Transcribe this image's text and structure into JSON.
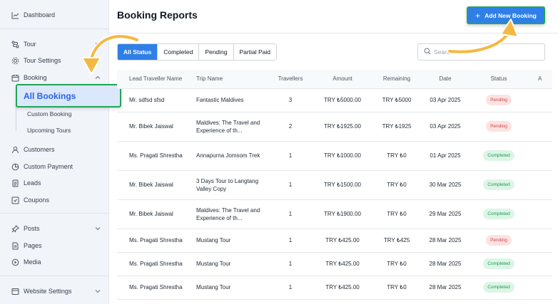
{
  "sidebar": {
    "items": [
      {
        "label": "Dashboard",
        "icon": "chart-line-icon"
      },
      {
        "label": "Tour",
        "icon": "route-icon"
      },
      {
        "label": "Tour Settings",
        "icon": "gear-icon"
      },
      {
        "label": "Booking",
        "icon": "calendar-icon"
      },
      {
        "label": "Customers",
        "icon": "user-icon"
      },
      {
        "label": "Custom Payment",
        "icon": "pie-chart-icon"
      },
      {
        "label": "Leads",
        "icon": "document-icon"
      },
      {
        "label": "Coupons",
        "icon": "coupon-icon"
      },
      {
        "label": "Posts",
        "icon": "pin-icon"
      },
      {
        "label": "Pages",
        "icon": "page-icon"
      },
      {
        "label": "Media",
        "icon": "media-icon"
      },
      {
        "label": "Website Settings",
        "icon": "settings-panel-icon"
      }
    ],
    "booking_sub": {
      "active": "All Bookings",
      "items": [
        "Custom Booking",
        "Upcoming Tours"
      ]
    }
  },
  "header": {
    "title": "Booking Reports",
    "add_button": "Add New Booking",
    "add_icon": "+"
  },
  "filters": [
    "All Status",
    "Completed",
    "Pending",
    "Partial Paid"
  ],
  "search": {
    "placeholder": "Search"
  },
  "table": {
    "columns": [
      "Lead Traveller Name",
      "Trip Name",
      "Travellers",
      "Amount",
      "Remaining",
      "Date",
      "Status",
      "A"
    ],
    "rows": [
      {
        "name": "Mr. sdfsd sfsd",
        "trip": "Fantastic Maldives",
        "travellers": "3",
        "amount": "TRY ₺5000.00",
        "remaining": "TRY ₺5000",
        "date": "03 Apr 2025",
        "status": "Pending"
      },
      {
        "name": "Mr. Bibek Jaiswal",
        "trip": "Maldives: The Travel and Experience of th...",
        "travellers": "2",
        "amount": "TRY ₺1925.00",
        "remaining": "TRY ₺1925",
        "date": "03 Apr 2025",
        "status": "Pending"
      },
      {
        "name": "Ms. Pragati Shrestha",
        "trip": "Annapurna Jomsom Trek",
        "travellers": "1",
        "amount": "TRY ₺1000.00",
        "remaining": "TRY ₺0",
        "date": "01 Apr 2025",
        "status": "Completed"
      },
      {
        "name": "Mr. Bibek Jaiswal",
        "trip": "3 Days Tour to Langtang Valley Copy",
        "travellers": "1",
        "amount": "TRY ₺1500.00",
        "remaining": "TRY ₺0",
        "date": "30 Mar 2025",
        "status": "Completed"
      },
      {
        "name": "Mr. Bibek Jaiswal",
        "trip": "Maldives: The Travel and Experience of th...",
        "travellers": "1",
        "amount": "TRY ₺1900.00",
        "remaining": "TRY ₺0",
        "date": "29 Mar 2025",
        "status": "Completed"
      },
      {
        "name": "Ms. Pragati Shrestha",
        "trip": "Mustang Tour",
        "travellers": "1",
        "amount": "TRY ₺425.00",
        "remaining": "TRY ₺425",
        "date": "28 Mar 2025",
        "status": "Pending"
      },
      {
        "name": "Ms. Pragati Shrestha",
        "trip": "Mustang Tour",
        "travellers": "1",
        "amount": "TRY ₺425.00",
        "remaining": "TRY ₺0",
        "date": "28 Mar 2025",
        "status": "Completed"
      },
      {
        "name": "Ms. Pragati Shrestha",
        "trip": "Mustang Tour",
        "travellers": "1",
        "amount": "TRY ₺425.00",
        "remaining": "TRY ₺0",
        "date": "28 Mar 2025",
        "status": "Completed"
      }
    ]
  },
  "colors": {
    "accent": "#2f7fe8",
    "highlight_border": "#22a55a",
    "annotation_arrow": "#f5b841",
    "pending": "#d04444",
    "completed": "#1f9956"
  }
}
